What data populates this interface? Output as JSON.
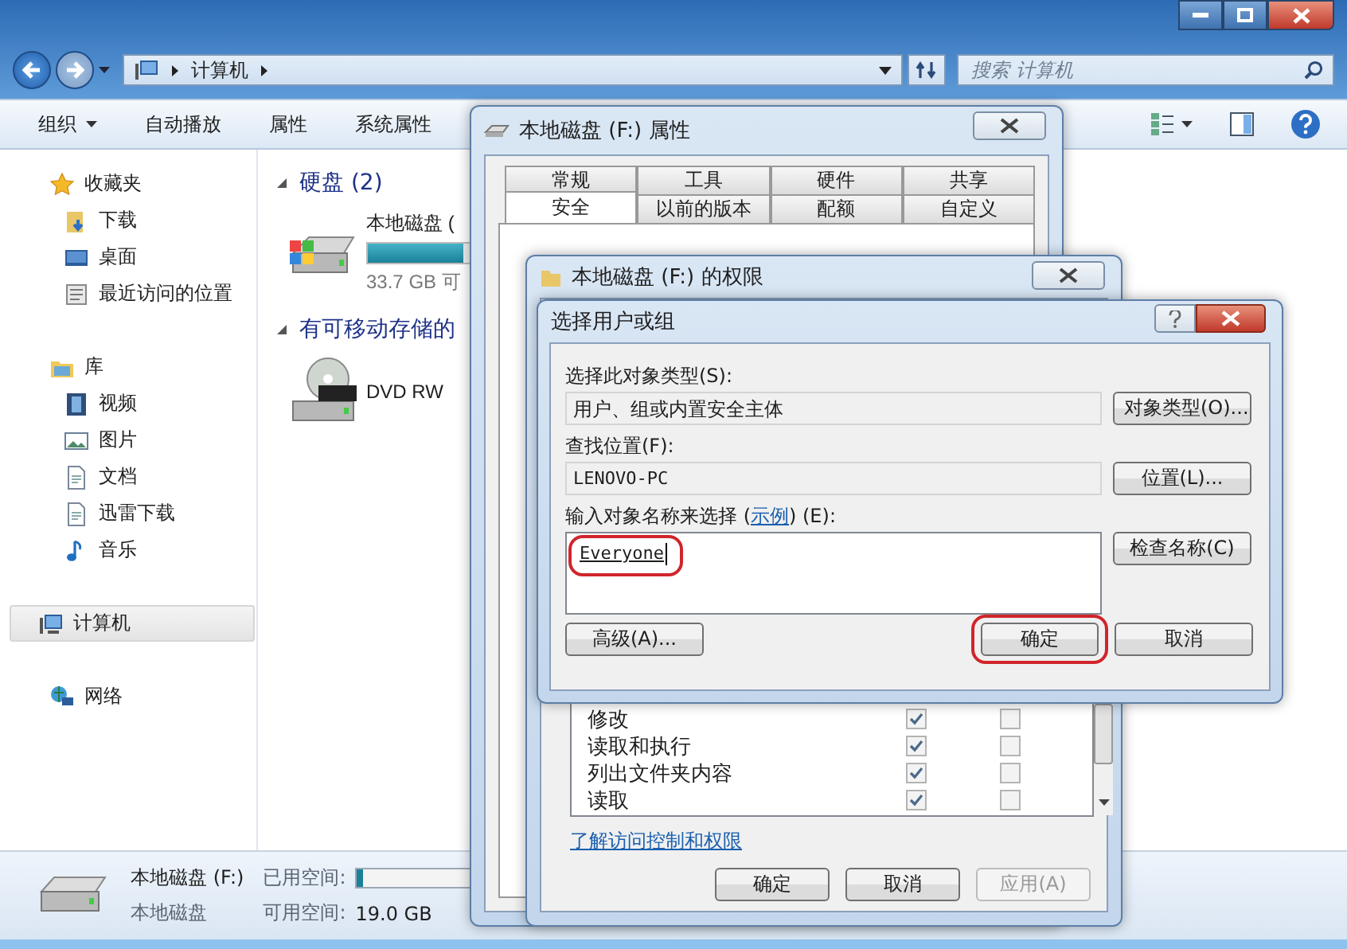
{
  "explorer": {
    "address": {
      "path": "计算机"
    },
    "search": {
      "placeholder": "搜索 计算机"
    },
    "toolbar": [
      {
        "label": "组织",
        "kind": "menu"
      },
      {
        "label": "自动播放",
        "kind": "plain"
      },
      {
        "label": "属性",
        "kind": "plain"
      },
      {
        "label": "系统属性",
        "kind": "plain"
      }
    ],
    "nav": [
      {
        "label": "收藏夹",
        "kind": "favorites",
        "selected": false,
        "children": [
          {
            "label": "下载",
            "kind": "downloads",
            "selected": false
          },
          {
            "label": "桌面",
            "kind": "desktop",
            "selected": false
          },
          {
            "label": "最近访问的位置",
            "kind": "recent",
            "selected": false
          }
        ]
      },
      {
        "label": "库",
        "kind": "libraries",
        "selected": false,
        "children": [
          {
            "label": "视频",
            "kind": "videos",
            "selected": false
          },
          {
            "label": "图片",
            "kind": "pictures",
            "selected": false
          },
          {
            "label": "文档",
            "kind": "documents",
            "selected": false
          },
          {
            "label": "迅雷下载",
            "kind": "documents",
            "selected": false
          },
          {
            "label": "音乐",
            "kind": "music",
            "selected": false
          }
        ]
      },
      {
        "label": "计算机",
        "kind": "computer",
        "selected": true
      },
      {
        "label": "网络",
        "kind": "network",
        "selected": false
      }
    ],
    "groups": [
      {
        "title": "硬盘 (2)",
        "items": [
          {
            "kind": "hdd",
            "name": "本地磁盘 (",
            "level": 0.6,
            "free": "33.7 GB 可"
          }
        ]
      },
      {
        "title": "有可移动存储的",
        "items": [
          {
            "kind": "dvd",
            "name": "DVD RW"
          }
        ]
      }
    ],
    "details": {
      "name": "本地磁盘 (F:)",
      "type": "本地磁盘",
      "used_label": "已用空间:",
      "level": 0.03,
      "free_label": "可用空间:",
      "free_value": "19.0 GB"
    }
  },
  "properties_dialog": {
    "title": "本地磁盘 (F:) 属性",
    "tab_rows": [
      {
        "tabs": [
          {
            "label": "常规",
            "selected": false
          },
          {
            "label": "工具",
            "selected": false
          },
          {
            "label": "硬件",
            "selected": false
          },
          {
            "label": "共享",
            "selected": false
          }
        ]
      },
      {
        "tabs": [
          {
            "label": "安全",
            "selected": true
          },
          {
            "label": "以前的版本",
            "selected": false
          },
          {
            "label": "配额",
            "selected": false
          },
          {
            "label": "自定义",
            "selected": false
          }
        ]
      }
    ]
  },
  "permissions_dialog": {
    "title": "本地磁盘 (F:) 的权限",
    "permissions": [
      {
        "name": "修改",
        "allow": true,
        "deny": false
      },
      {
        "name": "读取和执行",
        "allow": true,
        "deny": false
      },
      {
        "name": "列出文件夹内容",
        "allow": true,
        "deny": false
      },
      {
        "name": "读取",
        "allow": true,
        "deny": false
      }
    ],
    "link": "了解访问控制和权限",
    "buttons": [
      {
        "label": "确定",
        "disabled": false
      },
      {
        "label": "取消",
        "disabled": false
      },
      {
        "label": "应用(A)",
        "disabled": true
      }
    ]
  },
  "select_dialog": {
    "title": "选择用户或组",
    "object_type_label": "选择此对象类型(S):",
    "object_type_value": "用户、组或内置安全主体",
    "object_types_button": "对象类型(O)...",
    "location_label": "查找位置(F):",
    "location_value": "LENOVO-PC",
    "locations_button": "位置(L)...",
    "names_label_before": "输入对象名称来选择 (",
    "names_label_link": "示例",
    "names_label_after": ") (E):",
    "names_value": "Everyone",
    "names_highlighted": true,
    "check_names_button": "检查名称(C)",
    "advanced_button": "高级(A)...",
    "ok_button": {
      "label": "确定",
      "highlighted": true
    },
    "cancel_button": "取消"
  }
}
